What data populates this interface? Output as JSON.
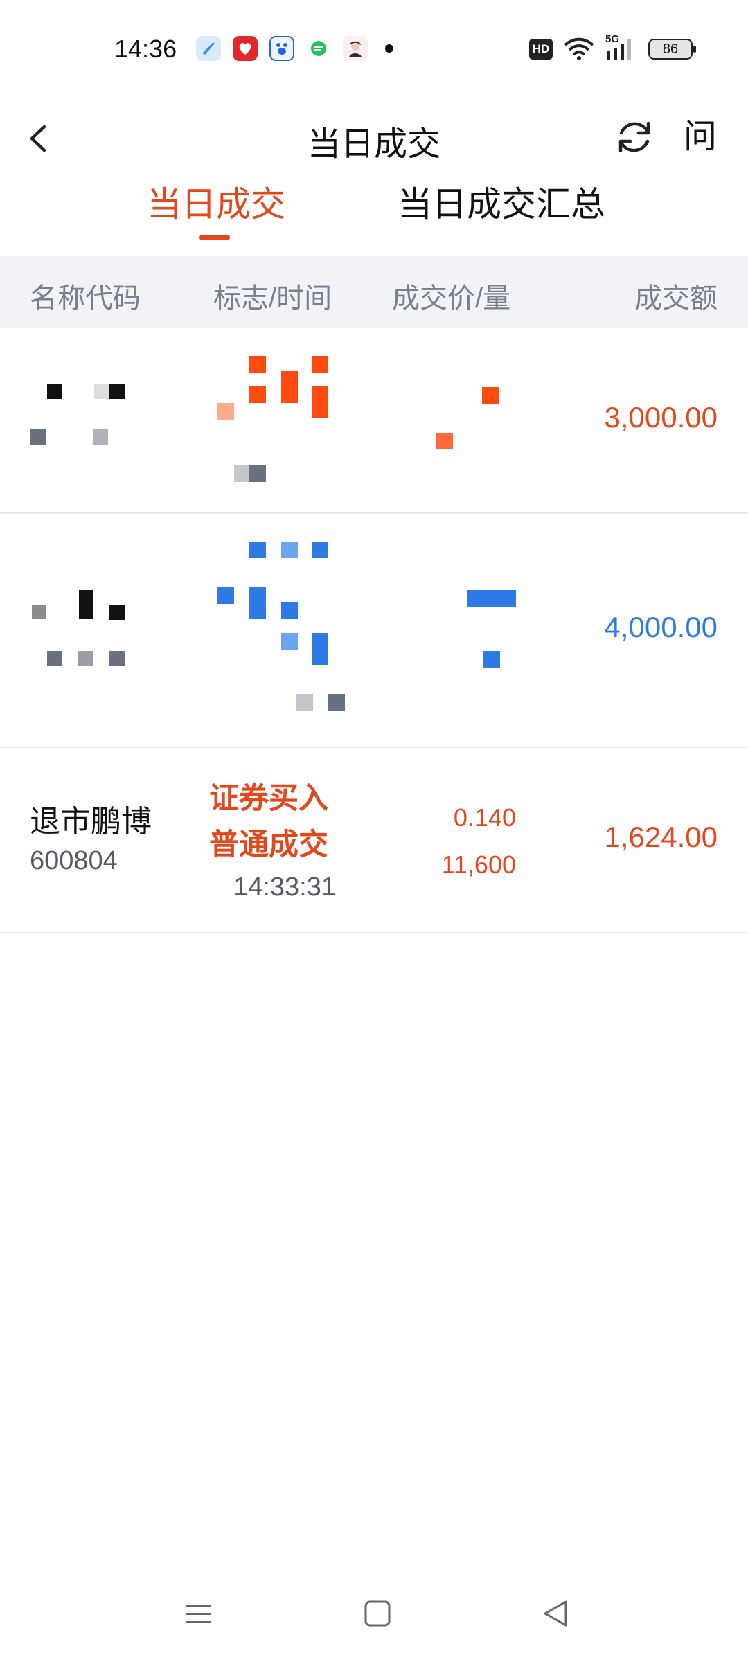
{
  "status_bar": {
    "time": "14:36",
    "battery": "86",
    "network": "5G",
    "hd_label": "HD",
    "app_icons": [
      "bird-app-icon",
      "red-app-icon",
      "baidu-paw-icon",
      "green-chat-icon",
      "avatar-app-icon"
    ]
  },
  "nav": {
    "title": "当日成交",
    "ask_label": "问"
  },
  "tabs": [
    {
      "label": "当日成交",
      "active": true
    },
    {
      "label": "当日成交汇总",
      "active": false
    }
  ],
  "table_header": {
    "col1": "名称代码",
    "col2": "标志/时间",
    "col3": "成交价/量",
    "col4": "成交额"
  },
  "rows": [
    {
      "amount": "3,000.00",
      "color": "#e5461a",
      "masked": true
    },
    {
      "amount": "4,000.00",
      "color": "#2f7be6",
      "masked": true
    },
    {
      "name": "退市鹏博",
      "code": "600804",
      "flag1": "证券买入",
      "flag2": "普通成交",
      "time": "14:33:31",
      "price": "0.140",
      "qty": "11,600",
      "amount": "1,624.00",
      "color": "#e5461a",
      "masked": false
    }
  ],
  "colors": {
    "accent": "#e5461a",
    "blue": "#2f7be6",
    "header_bg": "#f2f3f7"
  }
}
